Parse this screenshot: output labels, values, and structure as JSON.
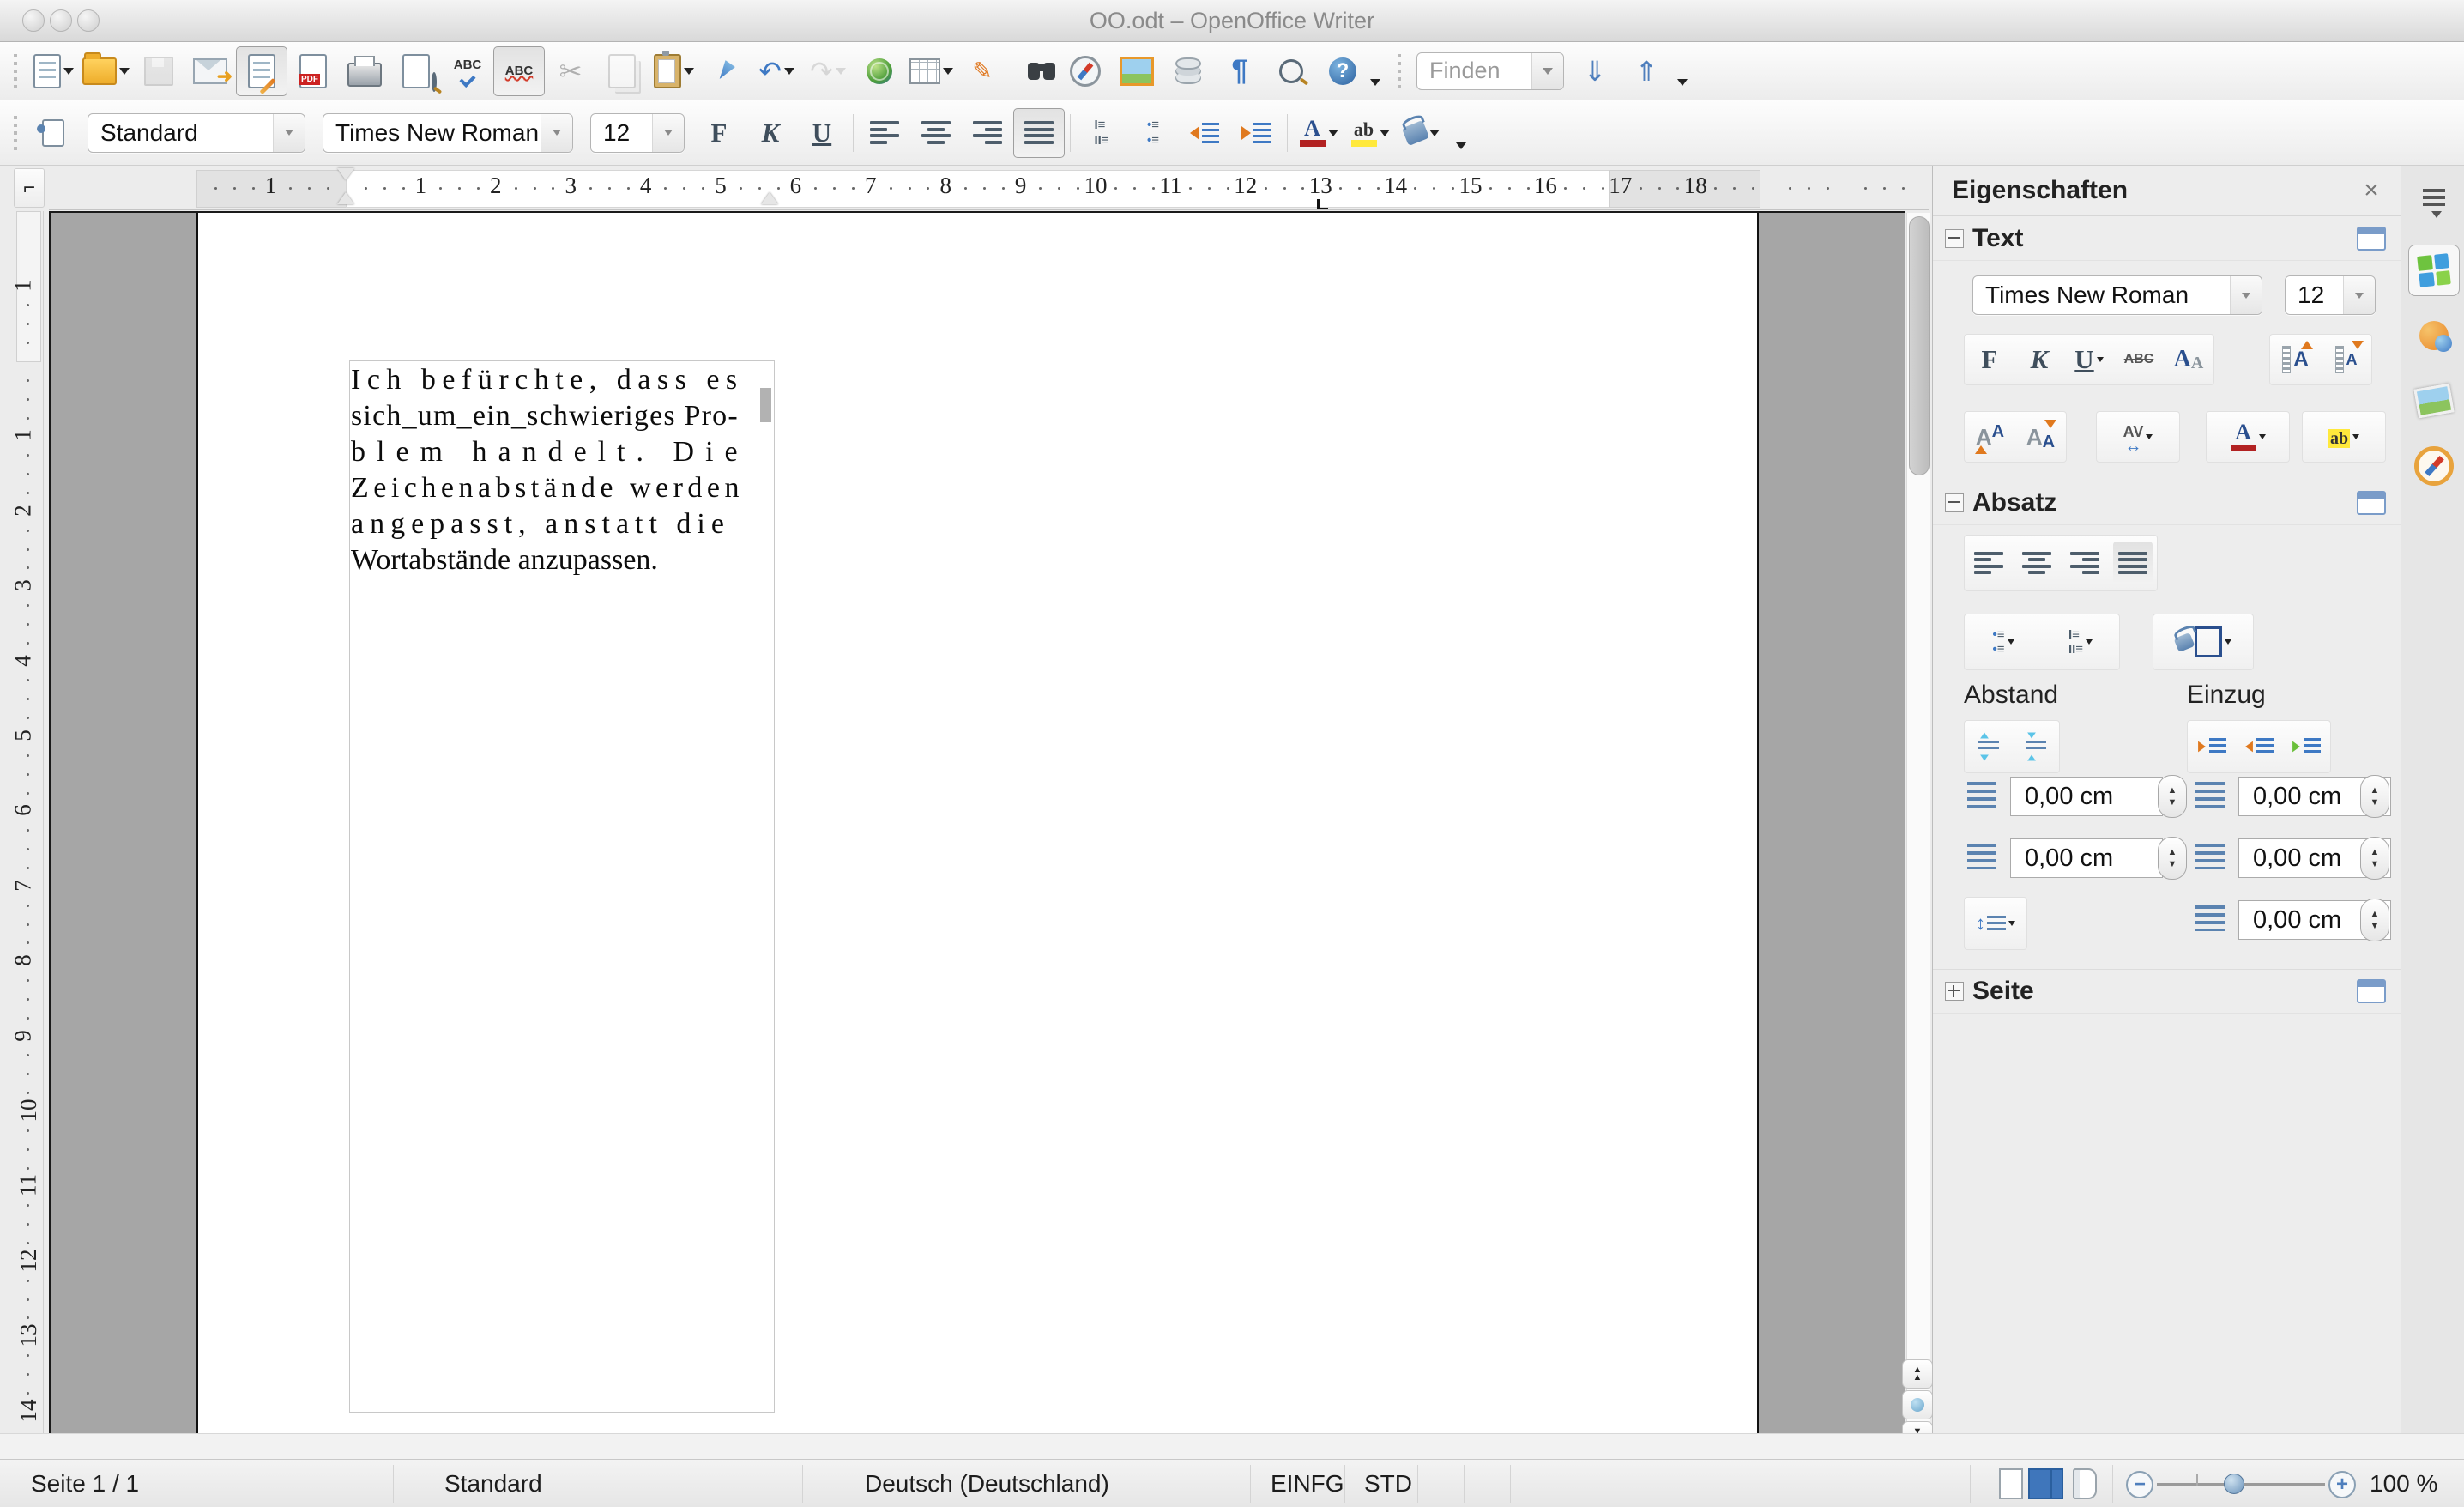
{
  "window": {
    "title": "OO.odt – OpenOffice Writer"
  },
  "toolbars": {
    "find_value": "Finden",
    "style_value": "Standard",
    "font_value": "Times New Roman",
    "size_value": "12",
    "glyphs": {
      "bold": "F",
      "italic": "K",
      "underline": "U",
      "spell": "ABC",
      "autospell": "ABC",
      "pdf": "PDF",
      "pilcrow": "¶",
      "help": "?",
      "fontcolor": "A",
      "highlight": "ab",
      "strike": "ABC",
      "case": "Aa",
      "charspace": "AV",
      "undo": "↶",
      "redo": "↷",
      "cut": "✂",
      "find_down": "⇓",
      "find_up": "⇑",
      "numbered_list": "1≡\n2≡",
      "bullet_list": "•≡\n•≡",
      "sup": "A",
      "sub": "A"
    }
  },
  "ruler": {
    "h_numbers": [
      1,
      2,
      3,
      4,
      5,
      6,
      7,
      8,
      9,
      10,
      11,
      12,
      13,
      14,
      15,
      16,
      17,
      18
    ],
    "h_margin_numbers": [
      1
    ],
    "v_numbers": [
      1,
      2,
      3,
      4,
      5,
      6,
      7,
      8,
      9,
      10,
      11,
      12,
      13,
      14
    ],
    "v_margin_numbers": [
      1
    ]
  },
  "document": {
    "lines": [
      "Ich befürchte, dass es",
      "sich_um_ein_schwieriges Pro-",
      "blem handelt. Die",
      "Zeichenabstände werden",
      "angepasst, anstatt die",
      "Wortabstände anzupassen."
    ]
  },
  "sidebar": {
    "title": "Eigenschaften",
    "text_section": {
      "label": "Text",
      "font": "Times New Roman",
      "size": "12"
    },
    "paragraph_section": {
      "label": "Absatz",
      "spacing_label": "Abstand",
      "indent_label": "Einzug",
      "spacing_above": "0,00 cm",
      "spacing_below": "0,00 cm",
      "indent_before": "0,00 cm",
      "indent_after": "0,00 cm",
      "indent_first": "0,00 cm"
    },
    "page_section": {
      "label": "Seite"
    }
  },
  "statusbar": {
    "page": "Seite 1 / 1",
    "style": "Standard",
    "language": "Deutsch (Deutschland)",
    "insert_mode": "EINFG",
    "selection_mode": "STD",
    "zoom": "100 %"
  },
  "colors": {
    "accent_blue": "#3f76bb",
    "canvas_gray": "#a6a6a6",
    "fontcolor_red": "#b22222",
    "highlight_yellow": "#ffe93c"
  }
}
